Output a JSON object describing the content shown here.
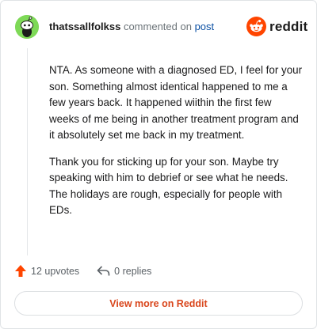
{
  "header": {
    "username": "thatssallfolkss",
    "commented_on_text": "commented on",
    "post_link_label": "post"
  },
  "brand": {
    "name": "reddit",
    "logo_icon": "reddit-logo-icon",
    "accent_color": "#ff4500"
  },
  "comment": {
    "paragraphs": [
      "NTA. As someone with a diagnosed ED, I feel for your son. Something almost identical happened to me a few years back. It happened wiithin the first few weeks of me being in another treatment program and it absolutely set me back in my treatment.",
      "Thank you for sticking up for your son. Maybe try speaking with him to debrief or see what he needs. The holidays are rough, especially for people with EDs."
    ]
  },
  "actions": {
    "upvotes_label": "12 upvotes",
    "replies_label": "0 replies",
    "upvote_icon": "upvote-arrow-icon",
    "reply_icon": "reply-arrow-icon"
  },
  "view_more": {
    "label": "View more on Reddit",
    "color": "#d9461c"
  },
  "avatar": {
    "icon": "snoo-avatar-icon",
    "color": "#7ed957"
  }
}
